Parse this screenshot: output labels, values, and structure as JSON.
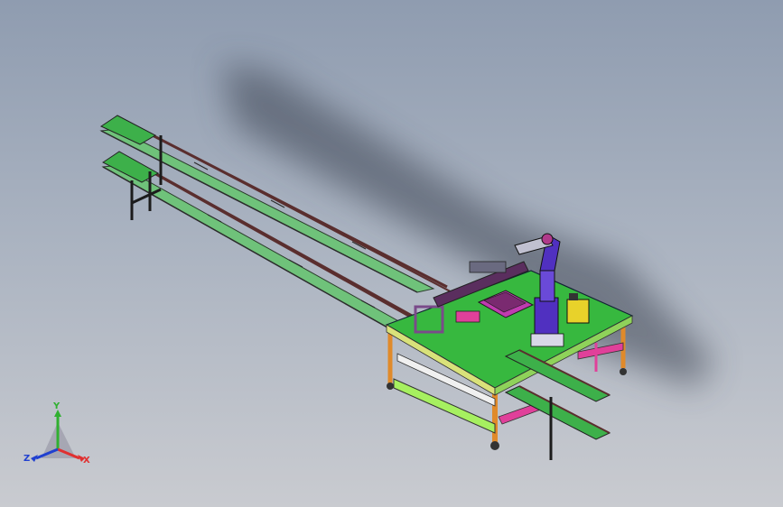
{
  "viewport": {
    "view_name": "isometric-cad-view"
  },
  "triad": {
    "x_label": "X",
    "y_label": "Y",
    "z_label": "Z",
    "colors": {
      "x": "#e03030",
      "y": "#30b030",
      "z": "#2040d0"
    }
  },
  "model": {
    "colors": {
      "conveyor_rail": "#5a2e2e",
      "conveyor_belt": "#5fb56a",
      "table_top": "#37b83f",
      "frame_orange": "#e08a2a",
      "frame_green": "#a6f060",
      "frame_pink": "#e0409a",
      "robot": "#5030c0",
      "fixture_magenta": "#c03bb0",
      "cabinet_yellow": "#e8d22a"
    }
  }
}
